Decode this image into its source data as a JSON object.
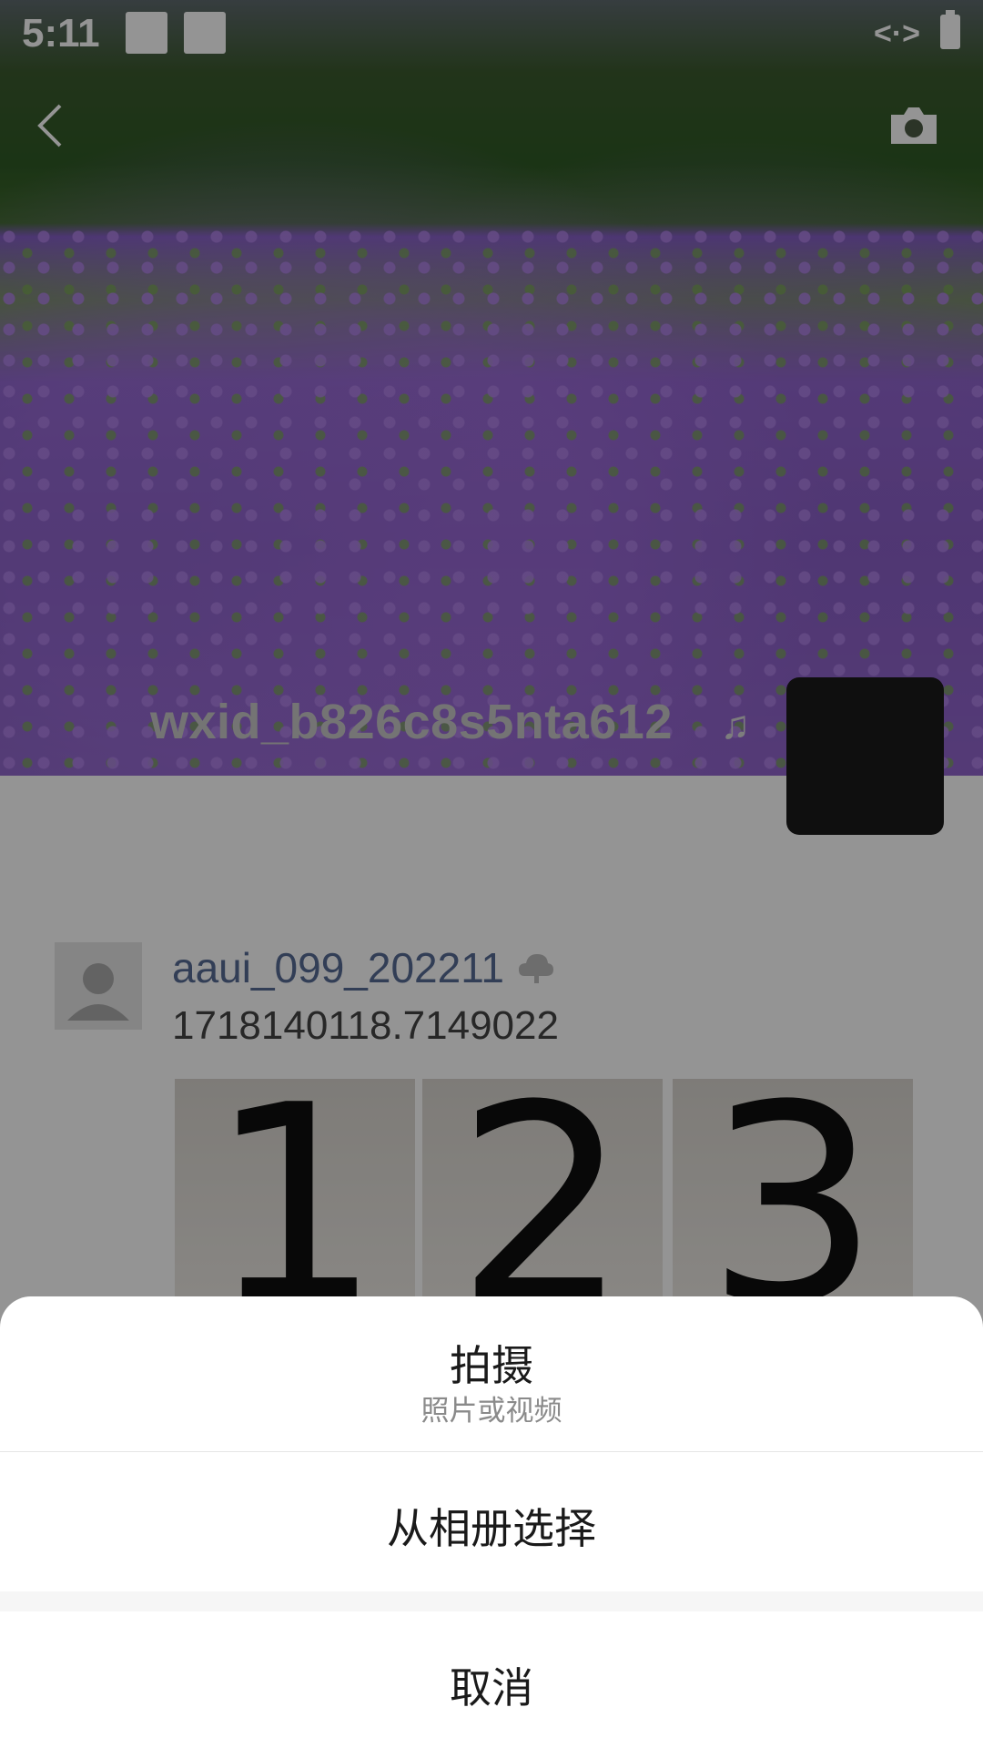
{
  "status_bar": {
    "time": "5:11",
    "code_icon": "<·>"
  },
  "cover": {
    "username": "wxid_b826c8s5nta612",
    "music_glyph": "♫"
  },
  "post": {
    "author": "aaui_099_202211",
    "timestamp": "1718140118.7149022",
    "images": [
      "1",
      "2",
      "3"
    ]
  },
  "action_sheet": {
    "take_title": "拍摄",
    "take_subtitle": "照片或视频",
    "album_label": "从相册选择",
    "cancel_label": "取消"
  },
  "colors": {
    "overlay": "rgba(0,0,0,0.42)",
    "link_blue": "#576b95",
    "sheet_bg": "#ffffff"
  },
  "icons": {
    "back": "chevron-left-icon",
    "camera": "camera-icon",
    "music": "music-note-icon",
    "cloud": "cloud-icon",
    "avatar": "default-avatar-icon",
    "battery": "battery-icon"
  }
}
